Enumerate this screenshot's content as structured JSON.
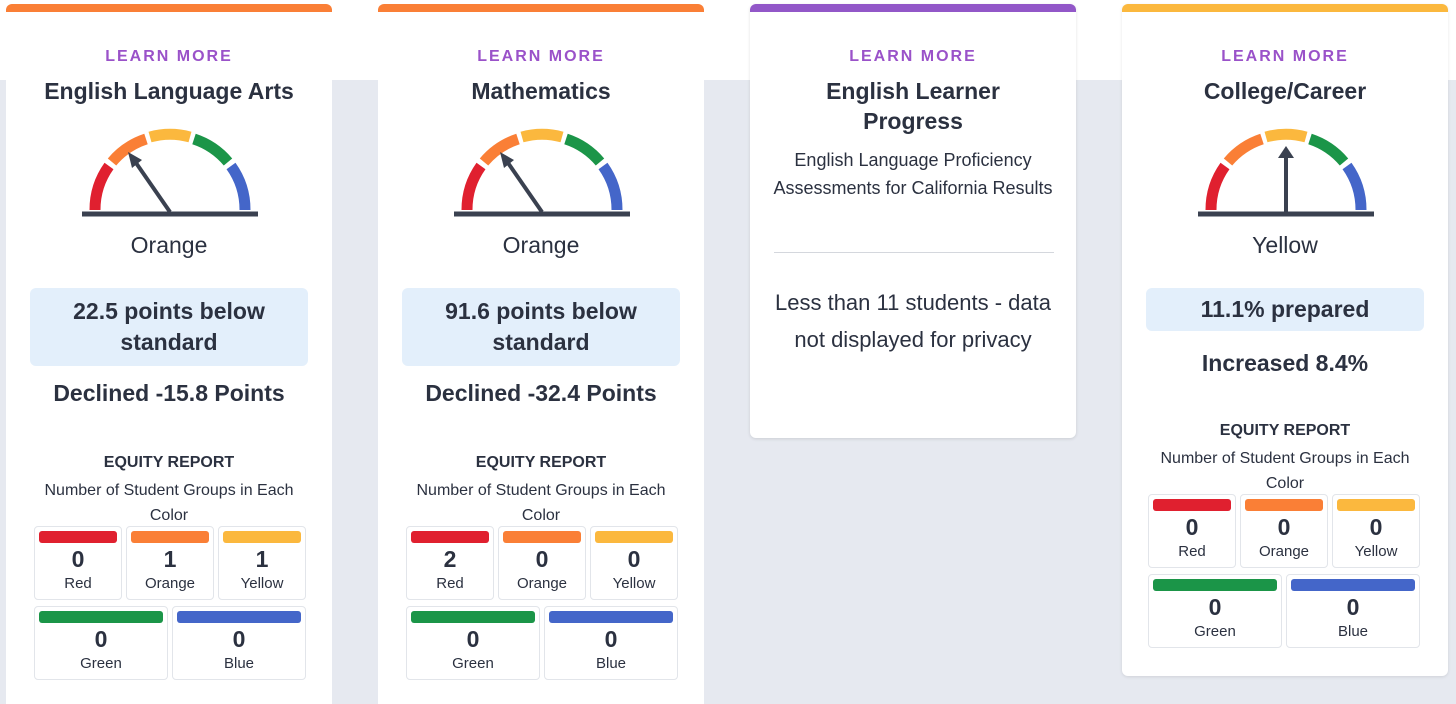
{
  "colors": {
    "red": "#e0202f",
    "orange": "#fa7f36",
    "yellow": "#fbb83e",
    "green": "#1b9548",
    "blue": "#4466c9",
    "purple": "#9257c8",
    "learn_more": "#9a52c9"
  },
  "cards": [
    {
      "learn_more": "LEARN MORE",
      "title": "English Language Arts",
      "gauge_level": "orange",
      "color_label": "Orange",
      "status": "22.5 points below standard",
      "change": "Declined -15.8 Points",
      "equity": {
        "title": "EQUITY REPORT",
        "subtitle": "Number of Student Groups in Each Color",
        "counts": [
          {
            "color": "red",
            "value": "0",
            "label": "Red"
          },
          {
            "color": "orange",
            "value": "1",
            "label": "Orange"
          },
          {
            "color": "yellow",
            "value": "1",
            "label": "Yellow"
          },
          {
            "color": "green",
            "value": "0",
            "label": "Green"
          },
          {
            "color": "blue",
            "value": "0",
            "label": "Blue"
          }
        ]
      }
    },
    {
      "learn_more": "LEARN MORE",
      "title": "Mathematics",
      "gauge_level": "orange",
      "color_label": "Orange",
      "status": "91.6 points below standard",
      "change": "Declined -32.4 Points",
      "equity": {
        "title": "EQUITY REPORT",
        "subtitle": "Number of Student Groups in Each Color",
        "counts": [
          {
            "color": "red",
            "value": "2",
            "label": "Red"
          },
          {
            "color": "orange",
            "value": "0",
            "label": "Orange"
          },
          {
            "color": "yellow",
            "value": "0",
            "label": "Yellow"
          },
          {
            "color": "green",
            "value": "0",
            "label": "Green"
          },
          {
            "color": "blue",
            "value": "0",
            "label": "Blue"
          }
        ]
      }
    },
    {
      "learn_more": "LEARN MORE",
      "title": "English Learner Progress",
      "subtitle": "English Language Proficiency Assessments for California Results",
      "message": "Less than 11 students - data not displayed for privacy"
    },
    {
      "learn_more": "LEARN MORE",
      "title": "College/Career",
      "gauge_level": "yellow",
      "color_label": "Yellow",
      "status": "11.1% prepared",
      "change": "Increased 8.4%",
      "equity": {
        "title": "EQUITY REPORT",
        "subtitle": "Number of Student Groups in Each Color",
        "counts": [
          {
            "color": "red",
            "value": "0",
            "label": "Red"
          },
          {
            "color": "orange",
            "value": "0",
            "label": "Orange"
          },
          {
            "color": "yellow",
            "value": "0",
            "label": "Yellow"
          },
          {
            "color": "green",
            "value": "0",
            "label": "Green"
          },
          {
            "color": "blue",
            "value": "0",
            "label": "Blue"
          }
        ]
      }
    }
  ]
}
